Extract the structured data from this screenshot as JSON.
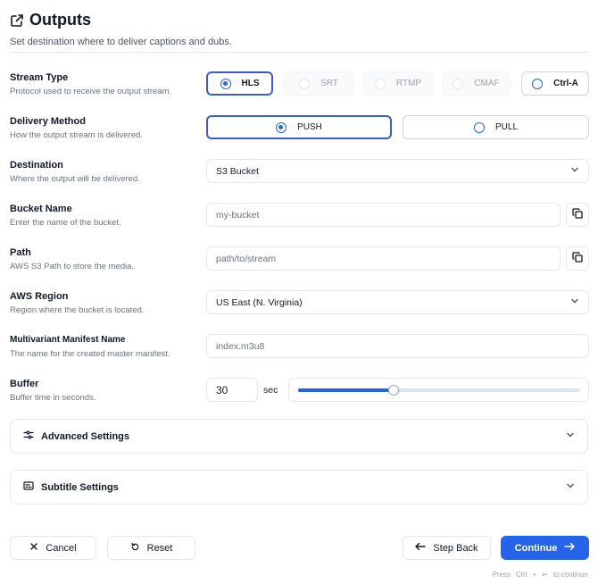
{
  "header": {
    "title": "Outputs",
    "subtitle": "Set destination where to deliver captions and dubs."
  },
  "stream_type": {
    "label": "Stream Type",
    "description": "Protocol used to receive the output stream.",
    "options": [
      "HLS",
      "SRT",
      "RTMP",
      "CMAF",
      "Ctrl-A"
    ],
    "selected": "HLS"
  },
  "delivery_method": {
    "label": "Delivery Method",
    "description": "How the output stream is delivered.",
    "options": [
      "PUSH",
      "PULL"
    ],
    "selected": "PUSH"
  },
  "destination": {
    "label": "Destination",
    "description": "Where the output will be delivered.",
    "value": "S3 Bucket"
  },
  "bucket_name": {
    "label": "Bucket Name",
    "description": "Enter the name of the bucket.",
    "placeholder": "my-bucket"
  },
  "path": {
    "label": "Path",
    "description": "AWS S3 Path to store the media.",
    "placeholder": "path/to/stream"
  },
  "aws_region": {
    "label": "AWS Region",
    "description": "Region where the bucket is located.",
    "value": "US East (N. Virginia)"
  },
  "manifest": {
    "label": "Multivariant Manifest Name",
    "description": "The name for the created master manifest.",
    "placeholder": "index.m3u8"
  },
  "buffer": {
    "label": "Buffer",
    "description": "Buffer time in seconds.",
    "value": "30",
    "unit": "sec",
    "slider_fraction": 0.34
  },
  "accordions": {
    "advanced": "Advanced Settings",
    "subtitle": "Subtitle Settings"
  },
  "footer": {
    "cancel": "Cancel",
    "reset": "Reset",
    "step_back": "Step Back",
    "continue": "Continue",
    "hint_press": "Press",
    "hint_key": "Ctrl",
    "hint_plus": "+",
    "hint_enter": "↵",
    "hint_to": "to continue"
  },
  "colors": {
    "accent": "#2563eb",
    "selected_border": "#3b5bdb",
    "border": "#e5e7eb",
    "muted_text": "#6b7280"
  },
  "icons": [
    "external-link-icon",
    "copy-icon",
    "chevron-down-icon",
    "sliders-icon",
    "subtitles-icon",
    "close-icon",
    "reset-icon",
    "arrow-left-icon",
    "arrow-right-icon"
  ]
}
